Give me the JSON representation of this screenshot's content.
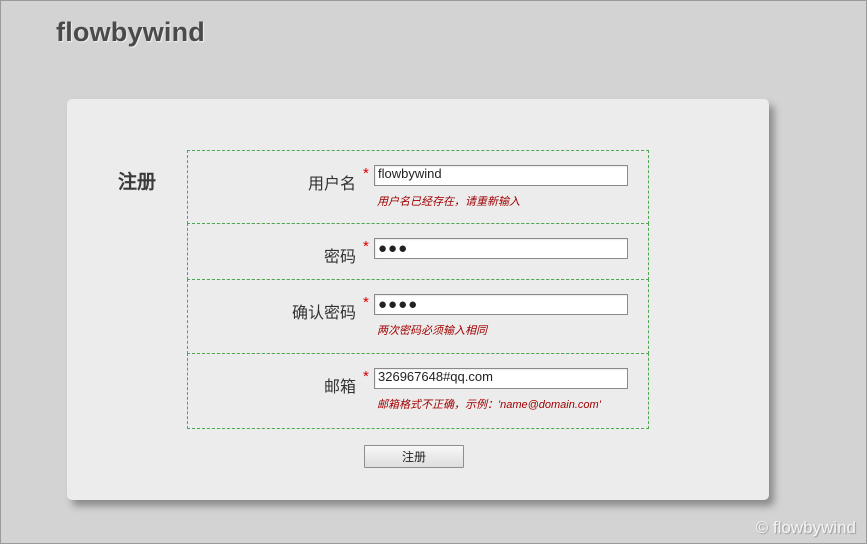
{
  "header": {
    "site_title": "flowbywind"
  },
  "form": {
    "heading": "注册",
    "required_mark": "*",
    "fields": [
      {
        "label": "用户名",
        "value": "flowbywind",
        "type": "text",
        "error": "用户名已经存在，请重新输入"
      },
      {
        "label": "密码",
        "value": "●●●",
        "type": "password",
        "error": ""
      },
      {
        "label": "确认密码",
        "value": "●●●●",
        "type": "password",
        "error": "两次密码必须输入相同"
      },
      {
        "label": "邮箱",
        "value": "326967648#qq.com",
        "type": "text",
        "error": "邮箱格式不正确，示例：'name@domain.com'"
      }
    ],
    "submit_label": "注册"
  },
  "watermark": "© flowbywind",
  "colors": {
    "background": "#d3d3d3",
    "card": "#ececec",
    "row_border": "#4da84d",
    "required": "#d40000",
    "error": "#a00000"
  }
}
